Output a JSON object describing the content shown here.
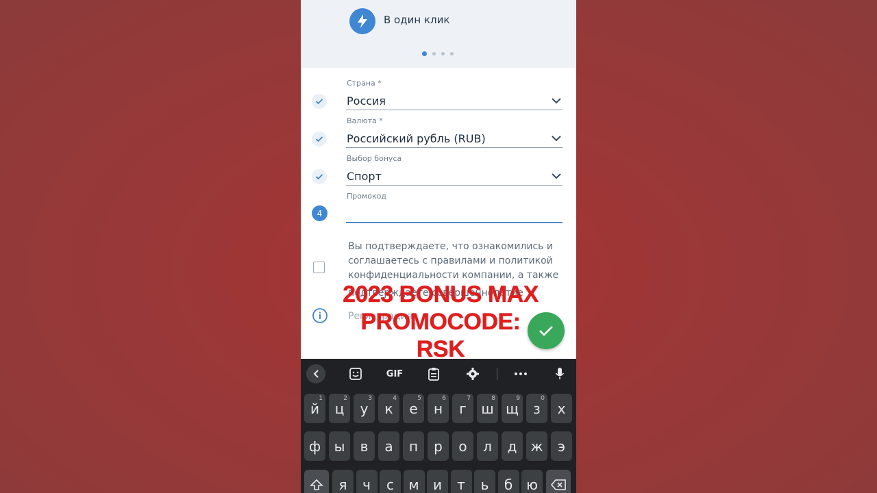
{
  "header": {
    "method_label": "В один клик",
    "page_dots": 4,
    "active_dot": 0
  },
  "form": {
    "country": {
      "label": "Страна *",
      "value": "Россия"
    },
    "currency": {
      "label": "Валюта *",
      "value": "Российский рубль (RUB)"
    },
    "bonus": {
      "label": "Выбор бонуса",
      "value": "Спорт"
    },
    "promo": {
      "label": "Промокод",
      "value": "",
      "step": "4"
    },
    "consent_text": "Вы подтверждаете, что ознакомились и соглашаетесь с правилами и политикой конфиденциальности компании, а также",
    "consent_text_cut": "подтверждаете совершеннолетие",
    "info_text": "Регистрация"
  },
  "overlay": {
    "line1": "2023 BONUS MAX",
    "line2": "PROMOCODE: RSK"
  },
  "keyboard": {
    "toolbar": {
      "gif": "GIF"
    },
    "row1": [
      {
        "k": "й",
        "h": "1"
      },
      {
        "k": "ц",
        "h": "2"
      },
      {
        "k": "у",
        "h": "3"
      },
      {
        "k": "к",
        "h": "4"
      },
      {
        "k": "е",
        "h": "5"
      },
      {
        "k": "н",
        "h": "6"
      },
      {
        "k": "г",
        "h": "7"
      },
      {
        "k": "ш",
        "h": "8"
      },
      {
        "k": "щ",
        "h": "9"
      },
      {
        "k": "з",
        "h": "0"
      },
      {
        "k": "х",
        "h": ""
      }
    ],
    "row2": [
      "ф",
      "ы",
      "в",
      "а",
      "п",
      "р",
      "о",
      "л",
      "д",
      "ж",
      "э"
    ],
    "row3": [
      "я",
      "ч",
      "с",
      "м",
      "и",
      "т",
      "ь",
      "б",
      "ю"
    ]
  },
  "colors": {
    "accent": "#3f86d3",
    "success": "#3aa85a",
    "overlay": "#e11d1d",
    "background": "#9a3838"
  }
}
